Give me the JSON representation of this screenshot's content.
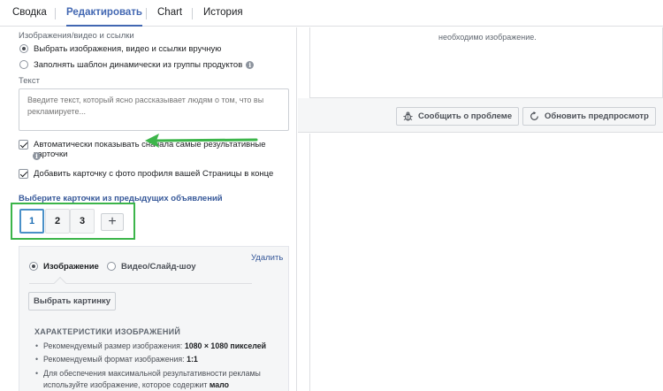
{
  "tabs": [
    {
      "label": "Сводка",
      "active": false
    },
    {
      "label": "Редактировать",
      "active": true
    },
    {
      "label": "Chart",
      "active": false
    },
    {
      "label": "История",
      "active": false
    }
  ],
  "left": {
    "media_section_title": "Изображения/видео и ссылки",
    "media_options": [
      {
        "label": "Выбрать изображения, видео и ссылки вручную",
        "selected": true
      },
      {
        "label": "Заполнять шаблон динамически из группы продуктов",
        "selected": false,
        "info": "i"
      }
    ],
    "text_label": "Текст",
    "text_placeholder": "Введите текст, который ясно рассказывает людям о том, что вы рекламируете...",
    "checkboxes": [
      {
        "label": "Автоматически показывать сначала самые результативные карточки",
        "checked": true,
        "info": "i"
      },
      {
        "label": "Добавить карточку с фото профиля вашей Страницы в конце",
        "checked": true
      }
    ],
    "cards_title": "Выберите карточки из предыдущих объявлений",
    "cards": [
      "1",
      "2",
      "3"
    ],
    "selected_card": "1",
    "add_card": "+",
    "editor": {
      "delete": "Удалить",
      "media_types": [
        {
          "label": "Изображение",
          "selected": true
        },
        {
          "label": "Видео/Слайд-шоу",
          "selected": false
        }
      ],
      "choose_button": "Выбрать картинку",
      "specs_title": "ХАРАКТЕРИСТИКИ ИЗОБРАЖЕНИЙ",
      "specs": [
        {
          "text": "Рекомендуемый размер изображения: ",
          "bold": "1080 × 1080 пикселей"
        },
        {
          "text": "Рекомендуемый формат изображения: ",
          "bold": "1:1"
        },
        {
          "text": "Для обеспечения максимальной результативности рекламы используйте изображение, которое содержит ",
          "bold": "мало"
        }
      ]
    }
  },
  "right": {
    "preview_text": "необходимо изображение.",
    "report_button": "Сообщить о проблеме",
    "refresh_button": "Обновить предпросмотр"
  },
  "colors": {
    "accent": "#4267b2",
    "annotation_green": "#3cb54a",
    "selected_card_border": "#4a90c8"
  }
}
